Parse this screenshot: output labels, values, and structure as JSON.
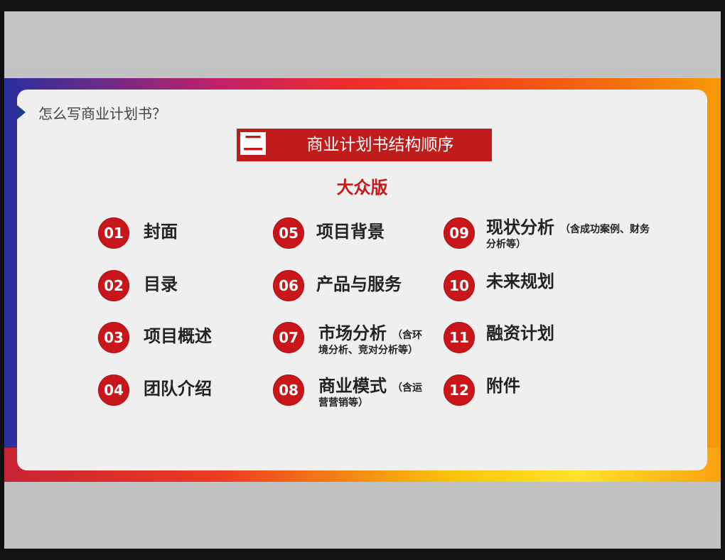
{
  "slide": {
    "title": "怎么写商业计划书？",
    "section_number": "二",
    "section_title": "商业计划书结构顺序",
    "edition": "大众版"
  },
  "items": [
    {
      "num": "01",
      "label": "封面"
    },
    {
      "num": "02",
      "label": "目录"
    },
    {
      "num": "03",
      "label": "项目概述"
    },
    {
      "num": "04",
      "label": "团队介绍"
    },
    {
      "num": "05",
      "label": "项目背景"
    },
    {
      "num": "06",
      "label": "产品与服务"
    },
    {
      "num": "07",
      "label": "市场分析",
      "note_line1": "（含环",
      "note_line2": "境分析、竞对分析等）"
    },
    {
      "num": "08",
      "label": "商业模式",
      "note_line1": "（含运",
      "note_line2": "营营销等）"
    },
    {
      "num": "09",
      "label": "现状分析",
      "note_line1": "（含成功案例、财务",
      "note_line2": "分析等）"
    },
    {
      "num": "10",
      "label": "未来规划"
    },
    {
      "num": "11",
      "label": "融资计划"
    },
    {
      "num": "12",
      "label": "附件"
    }
  ],
  "colors": {
    "accent_red": "#c01c1c",
    "card_bg": "#efefef",
    "title_arrow": "#1f3c88"
  }
}
